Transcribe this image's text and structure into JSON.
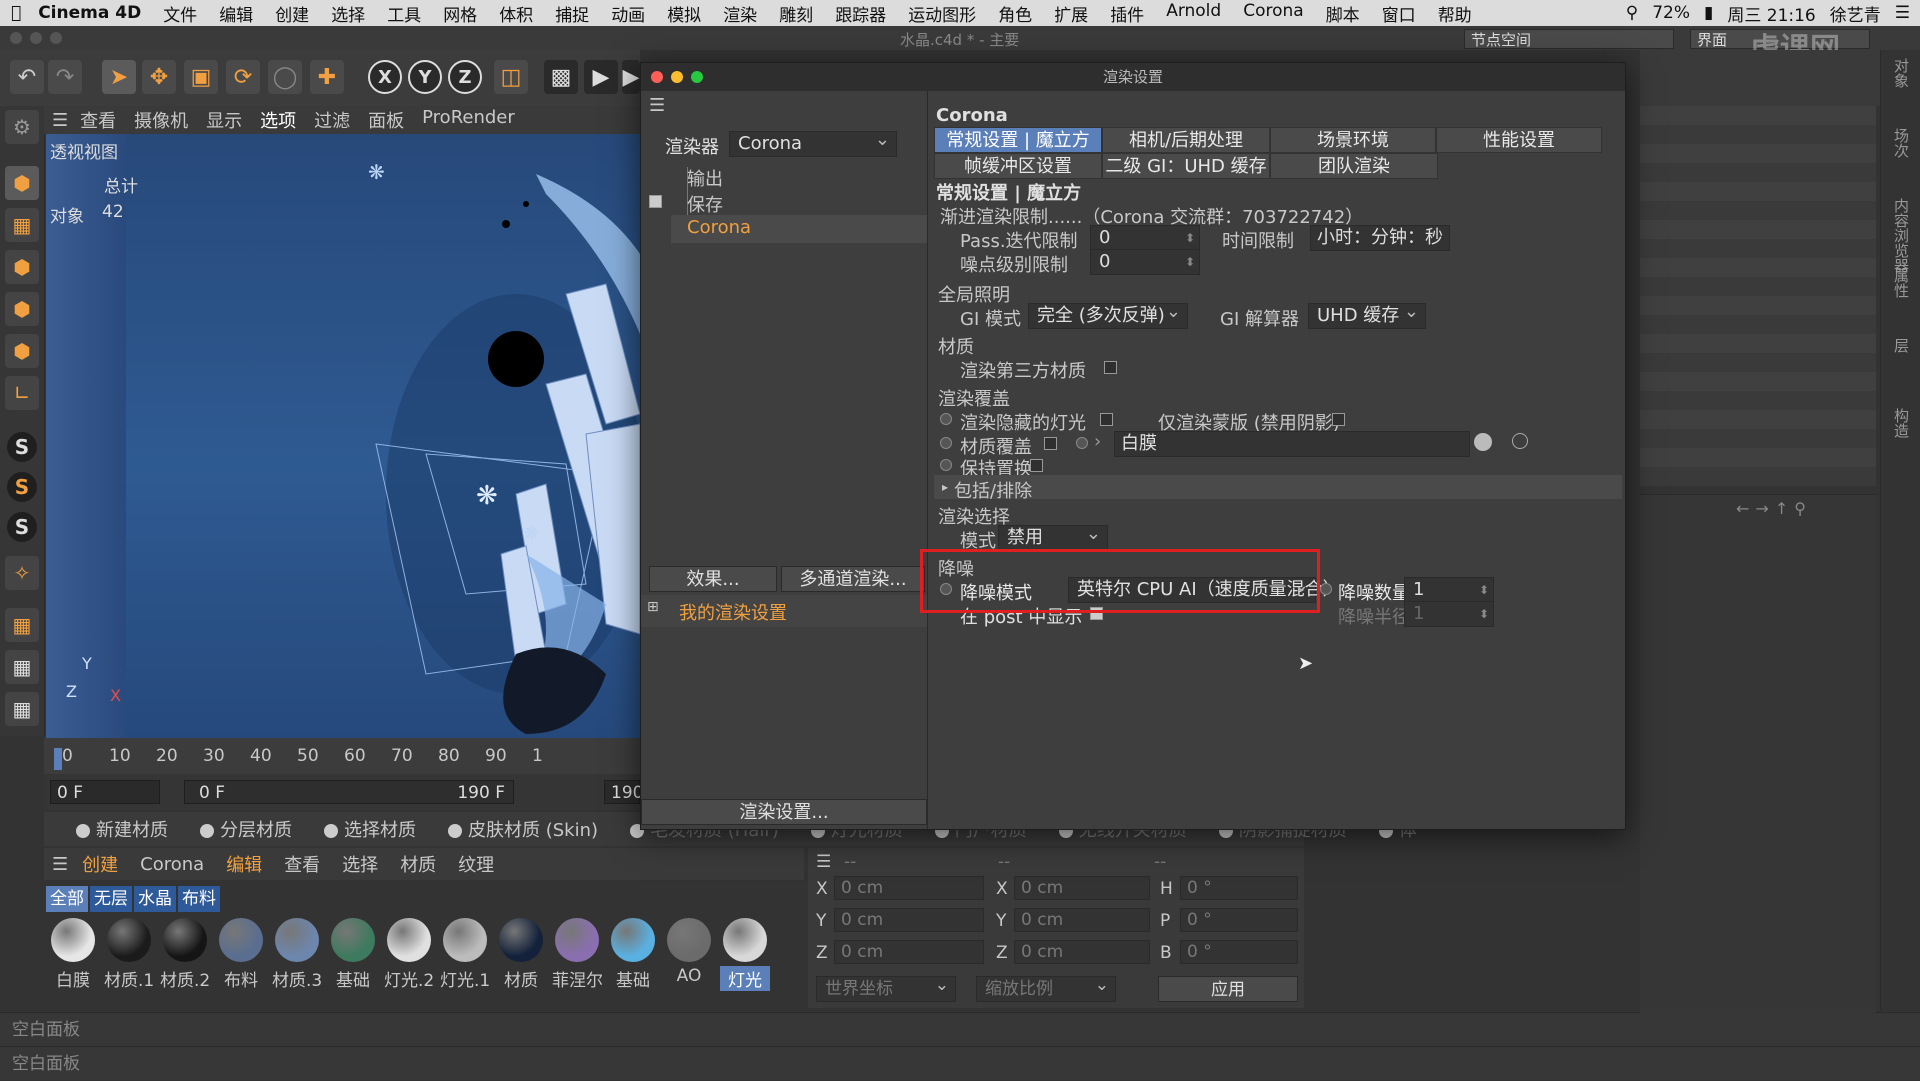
{
  "menubar": {
    "app": "Cinema 4D",
    "items": [
      "文件",
      "编辑",
      "创建",
      "选择",
      "工具",
      "网格",
      "体积",
      "捕捉",
      "动画",
      "模拟",
      "渲染",
      "雕刻",
      "跟踪器",
      "运动图形",
      "角色",
      "扩展",
      "插件",
      "Arnold",
      "Corona",
      "脚本",
      "窗口",
      "帮助"
    ],
    "battery": "72%",
    "clock": "周三 21:16",
    "user": "徐艺青"
  },
  "window_title": "水晶.c4d * - 主要",
  "node_space_label": "节点空间",
  "layout_label": "界面",
  "watermark": "虎课网",
  "viewport": {
    "menu": [
      "查看",
      "摄像机",
      "显示",
      "选项",
      "过滤",
      "面板",
      "ProRender"
    ],
    "name": "透视视图",
    "total_label": "总计",
    "objects_label": "对象",
    "objects_count": "42",
    "axis_y": "Y",
    "axis_z": "Z",
    "axis_x": "X"
  },
  "timeline": {
    "ticks": [
      "0",
      "10",
      "20",
      "30",
      "40",
      "50",
      "60",
      "70",
      "80",
      "90",
      "1"
    ],
    "frame_start": "0 F",
    "frame_min": "0 F",
    "frame_end": "190 F",
    "frame_max": "190"
  },
  "material_bar": {
    "items": [
      "新建材质",
      "分层材质",
      "选择材质",
      "皮肤材质 (Skin)",
      "毛发材质 (Hair)",
      "灯光材质",
      "门户材质",
      "无线开关材质",
      "阴影捕捉材质",
      "体"
    ]
  },
  "material_menu": [
    "创建",
    "Corona",
    "编辑",
    "查看",
    "选择",
    "材质",
    "纹理"
  ],
  "material_filters": [
    "全部",
    "无层",
    "水晶",
    "布料"
  ],
  "materials": [
    {
      "name": "白膜",
      "color": "#e6e6e6"
    },
    {
      "name": "材质.1",
      "color": "#1b1b1b"
    },
    {
      "name": "材质.2",
      "color": "#151515"
    },
    {
      "name": "布料",
      "color": "#5a6e90"
    },
    {
      "name": "材质.3",
      "color": "#6d86ad"
    },
    {
      "name": "基础",
      "color": "#3e7a5e"
    },
    {
      "name": "灯光.2",
      "color": "#e0e0e0"
    },
    {
      "name": "灯光.1",
      "color": "#bcbcbc"
    },
    {
      "name": "材质",
      "color": "#13213a"
    },
    {
      "name": "菲涅尔",
      "color": "#8a6fb0"
    },
    {
      "name": "基础",
      "color": "#5ab0e0"
    },
    {
      "name": "AO",
      "color": "#6b6b6b"
    },
    {
      "name": "灯光",
      "color": "#d8d8d8"
    }
  ],
  "coords": {
    "header_left": "--",
    "header_mid": "--",
    "header_right": "--",
    "rows": [
      {
        "a": "X",
        "av": "0 cm",
        "b": "X",
        "bv": "0 cm",
        "c": "H",
        "cv": "0 °"
      },
      {
        "a": "Y",
        "av": "0 cm",
        "b": "Y",
        "bv": "0 cm",
        "c": "P",
        "cv": "0 °"
      },
      {
        "a": "Z",
        "av": "0 cm",
        "b": "Z",
        "bv": "0 cm",
        "c": "B",
        "cv": "0 °"
      }
    ],
    "world": "世界坐标",
    "scale": "缩放比例",
    "apply": "应用"
  },
  "bottom_panel_1": "空白面板",
  "bottom_panel_2": "空白面板",
  "right_tabs": [
    "对象",
    "场次",
    "内容浏览器",
    "属性",
    "层",
    "构造"
  ],
  "dialog": {
    "title": "渲染设置",
    "renderer_label": "渲染器",
    "renderer_value": "Corona",
    "tree": [
      "输出",
      "保存",
      "Corona"
    ],
    "effects_btn": "效果...",
    "multipass_btn": "多通道渲染...",
    "my_settings": "我的渲染设置",
    "settings_btn": "渲染设置...",
    "heading": "Corona",
    "tabs_row1": [
      "常规设置 | 魔立方",
      "相机/后期处理",
      "场景环境",
      "性能设置"
    ],
    "tabs_row2": [
      "帧缓冲区设置",
      "二级 GI：UHD 缓存",
      "团队渲染"
    ],
    "section_title": "常规设置 | 魔立方",
    "progressive_label": "渐进渲染限制......（Corona 交流群：703722742）",
    "pass_label": "Pass.迭代限制",
    "pass_value": "0",
    "time_label": "时间限制",
    "time_value": "小时：分钟：秒",
    "noise_label": "噪点级别限制",
    "noise_value": "0",
    "gi_section": "全局照明",
    "gi_mode_label": "GI 模式",
    "gi_mode_value": "完全 (多次反弹)",
    "gi_solver_label": "GI 解算器",
    "gi_solver_value": "UHD 缓存",
    "material_section": "材质",
    "third_party_label": "渲染第三方材质",
    "override_section": "渲染覆盖",
    "hidden_lights_label": "渲染隐藏的灯光",
    "mask_only_label": "仅渲染蒙版 (禁用阴影)",
    "mat_override_label": "材质覆盖",
    "mat_override_value": "白膜",
    "keep_displace_label": "保持置换",
    "include_exclude_label": "包括/排除",
    "render_select_section": "渲染选择",
    "mode_label": "模式",
    "mode_value": "禁用",
    "denoise_section": "降噪",
    "denoise_mode_label": "降噪模式",
    "denoise_mode_value": "英特尔 CPU AI（速度质量混合）",
    "denoise_amount_label": "降噪数量",
    "denoise_amount_value": "1",
    "denoise_radius_label": "降噪半径",
    "denoise_radius_value": "1",
    "post_display_label": "在 post 中显示"
  },
  "colors": {
    "accent_blue": "#5b7fb8",
    "highlight_red": "#e02020",
    "orange": "#f0a040"
  }
}
